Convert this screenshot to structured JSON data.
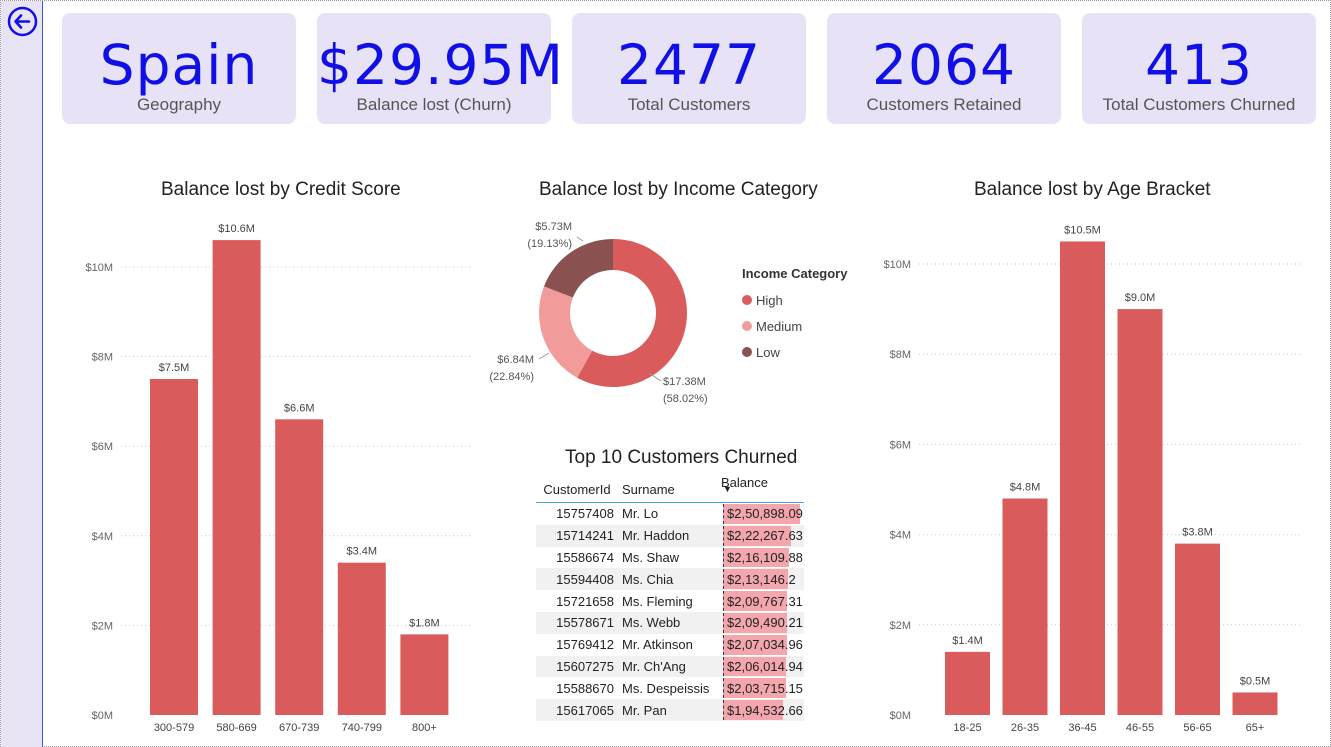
{
  "kpis": [
    {
      "value": "Spain",
      "label": "Geography"
    },
    {
      "value": "$29.95M",
      "label": "Balance lost (Churn)"
    },
    {
      "value": "2477",
      "label": "Total Customers"
    },
    {
      "value": "2064",
      "label": "Customers Retained"
    },
    {
      "value": "413",
      "label": "Total Customers Churned"
    }
  ],
  "colors": {
    "bar": "#d95b5b",
    "high": "#d95b5b",
    "medium": "#f29b9b",
    "low": "#8a5151",
    "kpi_text": "#1010e6",
    "kpi_bg": "#e8e2f7"
  },
  "chart_data": [
    {
      "type": "bar",
      "title": "Balance lost by Credit Score",
      "categories": [
        "300-579",
        "580-669",
        "670-739",
        "740-799",
        "800+"
      ],
      "values": [
        7.5,
        10.6,
        6.6,
        3.4,
        1.8
      ],
      "data_labels": [
        "$7.5M",
        "$10.6M",
        "$6.6M",
        "$3.4M",
        "$1.8M"
      ],
      "yticks": [
        "$0M",
        "$2M",
        "$4M",
        "$6M",
        "$8M",
        "$10M"
      ],
      "ylim": [
        0,
        11.2
      ],
      "grid": true
    },
    {
      "type": "pie",
      "title": "Balance lost by Income Category",
      "legend_title": "Income Category",
      "categories": [
        "High",
        "Medium",
        "Low"
      ],
      "values": [
        17.38,
        6.84,
        5.73
      ],
      "percents": [
        58.02,
        22.84,
        19.13
      ],
      "value_labels": [
        "$17.38M",
        "$6.84M",
        "$5.73M"
      ],
      "percent_labels": [
        "(58.02%)",
        "(22.84%)",
        "(19.13%)"
      ],
      "legend_placement": "right"
    },
    {
      "type": "bar",
      "title": "Balance lost by Age Bracket",
      "categories": [
        "18-25",
        "26-35",
        "36-45",
        "46-55",
        "56-65",
        "65+"
      ],
      "values": [
        1.4,
        4.8,
        10.5,
        9.0,
        3.8,
        0.5
      ],
      "data_labels": [
        "$1.4M",
        "$4.8M",
        "$10.5M",
        "$9.0M",
        "$3.8M",
        "$0.5M"
      ],
      "yticks": [
        "$0M",
        "$2M",
        "$4M",
        "$6M",
        "$8M",
        "$10M"
      ],
      "ylim": [
        0,
        10.5
      ],
      "grid": true
    },
    {
      "type": "table",
      "title": "Top 10 Customers Churned",
      "columns": [
        "CustomerId",
        "Surname",
        "Balance"
      ],
      "rows": [
        [
          "15757408",
          "Mr. Lo",
          "$2,50,898.09"
        ],
        [
          "15714241",
          "Mr. Haddon",
          "$2,22,267.63"
        ],
        [
          "15586674",
          "Ms. Shaw",
          "$2,16,109.88"
        ],
        [
          "15594408",
          "Ms. Chia",
          "$2,13,146.2"
        ],
        [
          "15721658",
          "Ms. Fleming",
          "$2,09,767.31"
        ],
        [
          "15578671",
          "Ms. Webb",
          "$2,09,490.21"
        ],
        [
          "15769412",
          "Mr. Atkinson",
          "$2,07,034.96"
        ],
        [
          "15607275",
          "Mr. Ch'Ang",
          "$2,06,014.94"
        ],
        [
          "15588670",
          "Ms. Despeissis",
          "$2,03,715.15"
        ],
        [
          "15617065",
          "Mr. Pan",
          "$1,94,532.66"
        ]
      ],
      "balances": [
        250898.09,
        222267.63,
        216109.88,
        213146.2,
        209767.31,
        209490.21,
        207034.96,
        206014.94,
        203715.15,
        194532.66
      ]
    }
  ]
}
